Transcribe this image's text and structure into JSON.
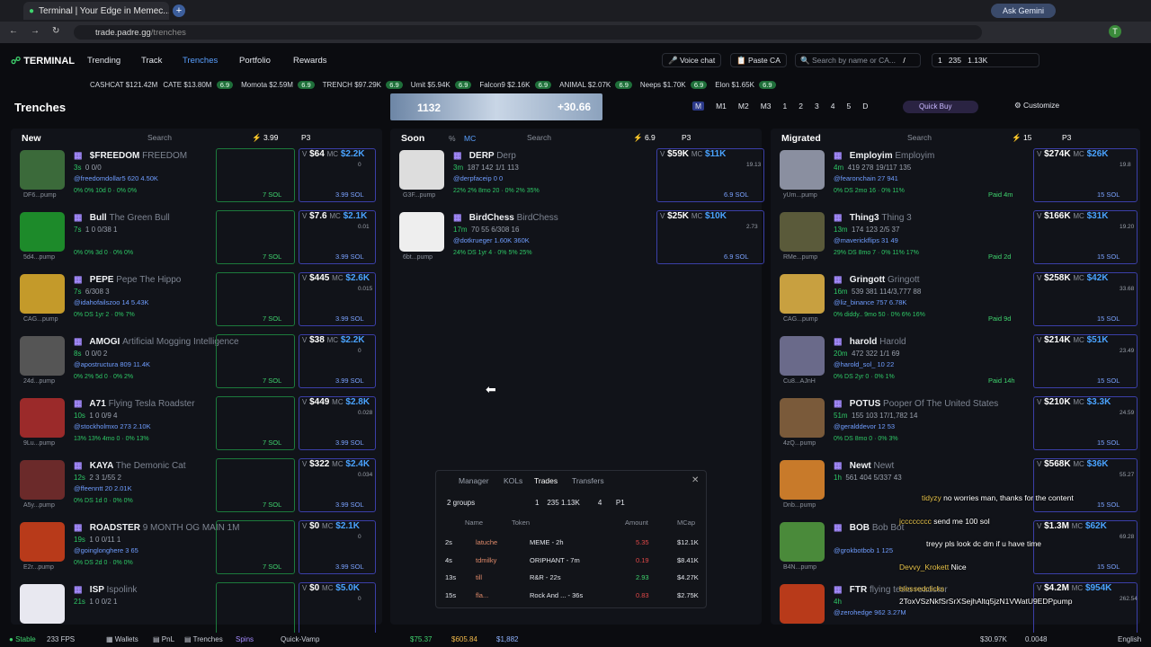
{
  "browser": {
    "tab_title": "Terminal | Your Edge in Memec...",
    "url_host": "trade.padre.gg",
    "url_path": "/trenches",
    "gemini_label": "Ask Gemini",
    "profile_initial": "T"
  },
  "nav": {
    "logo": "TERMINAL",
    "items": [
      "Trending",
      "Track",
      "Trenches",
      "Portfolio",
      "Rewards"
    ],
    "voice_chat": "Voice chat",
    "paste_ca": "Paste CA",
    "search_placeholder": "Search by name or CA...",
    "search_shortcut": "/",
    "wallet_count": "1",
    "wallet_a": "235",
    "wallet_b": "1.13K"
  },
  "ticker": [
    {
      "name": "CASHCAT",
      "value": "$121.42M"
    },
    {
      "name": "CATE",
      "value": "$13.80M",
      "pill": "6.9"
    },
    {
      "name": "Momota",
      "value": "$2.59M",
      "pill": "6.9"
    },
    {
      "name": "TRENCH",
      "value": "$97.29K",
      "pill": "6.9"
    },
    {
      "name": "Umit",
      "value": "$5.94K",
      "pill": "6.9"
    },
    {
      "name": "Falcon9",
      "value": "$2.16K",
      "pill": "6.9"
    },
    {
      "name": "ANIMAL",
      "value": "$2.07K",
      "pill": "6.9"
    },
    {
      "name": "Neeps",
      "value": "$1.70K",
      "pill": "6.9"
    },
    {
      "name": "Elon",
      "value": "$1.65K",
      "pill": "6.9"
    }
  ],
  "banner": {
    "left": "1132",
    "right": "+30.66"
  },
  "trenches": {
    "title": "Trenches",
    "presets": [
      "M",
      "M1",
      "M2",
      "M3",
      "1",
      "2",
      "3",
      "4",
      "5",
      "D"
    ],
    "quick_buy": "Quick Buy",
    "customize": "Customize"
  },
  "columns": {
    "new": {
      "title": "New",
      "search": "Search",
      "amount": "3.99",
      "preset": "P3"
    },
    "soon": {
      "title": "Soon",
      "tab1": "%",
      "tab2": "MC",
      "search": "Search",
      "amount": "6.9",
      "preset": "P3"
    },
    "migrated": {
      "title": "Migrated",
      "search": "Search",
      "amount": "15",
      "preset": "P3"
    }
  },
  "new_cards": [
    {
      "ticker": "$FREEDOM",
      "name": "FREEDOM",
      "age": "3s",
      "stats": "0  0/0",
      "social": "@freedomdollar5  620  4.50K",
      "metrics": "0%  0%  10d  0 · 0%  0%",
      "v": "$64",
      "mc": "$2.2K",
      "f": "0",
      "ca": "DF6...pump",
      "sol": "3.99 SOL",
      "sol2": "7 SOL",
      "img": "#3b6a3a"
    },
    {
      "ticker": "Bull",
      "name": "The Green Bull",
      "age": "7s",
      "stats": "1  0  0/38  1",
      "social": "",
      "metrics": "0%  0%  3d  0 · 0%  0%",
      "v": "$7.6",
      "mc": "$2.1K",
      "f": "0.01",
      "ca": "5d4...pump",
      "sol": "3.99 SOL",
      "sol2": "7 SOL",
      "img": "#1d8a2a"
    },
    {
      "ticker": "PEPE",
      "name": "Pepe The Hippo",
      "age": "7s",
      "stats": "6/308  3",
      "social": "@idahofailszoo  14  5.43K",
      "metrics": "0%  DS  1yr  2 · 0%  7%",
      "v": "$445",
      "mc": "$2.6K",
      "f": "0.015",
      "ca": "CAG...pump",
      "sol": "3.99 SOL",
      "sol2": "7 SOL",
      "img": "#c49a2a"
    },
    {
      "ticker": "AMOGI",
      "name": "Artificial Mogging Intelligence",
      "age": "8s",
      "stats": "0  0/0  2",
      "social": "@apostructura  809  11.4K",
      "metrics": "0%  2%  5d  0 · 0%  2%",
      "v": "$38",
      "mc": "$2.2K",
      "f": "0",
      "ca": "24d...pump",
      "sol": "3.99 SOL",
      "sol2": "7 SOL",
      "img": "#555"
    },
    {
      "ticker": "A71",
      "name": "Flying Tesla Roadster",
      "age": "10s",
      "stats": "1  0  0/9  4",
      "social": "@stockholmxo  273  2.10K",
      "metrics": "13%  13%  4mo  0 · 0%  13%",
      "v": "$449",
      "mc": "$2.8K",
      "f": "0.028",
      "ca": "9Lu...pump",
      "sol": "3.99 SOL",
      "sol2": "7 SOL",
      "img": "#9b2a2a"
    },
    {
      "ticker": "KAYA",
      "name": "The Demonic Cat",
      "age": "12s",
      "stats": "2  3  1/55  2",
      "social": "@ffeenntt  20  2.01K",
      "metrics": "0%  DS  1d  0 · 0%  0%",
      "v": "$322",
      "mc": "$2.4K",
      "f": "0.034",
      "ca": "A5y...pump",
      "sol": "3.99 SOL",
      "sol2": "7 SOL",
      "img": "#6b2a2a"
    },
    {
      "ticker": "ROADSTER",
      "name": "9 MONTH OG MAIN 1M",
      "age": "19s",
      "stats": "1  0  0/11  1",
      "social": "@goinglonghere  3  65",
      "metrics": "0%  DS  2d  0 · 0%  0%",
      "v": "$0",
      "mc": "$2.1K",
      "f": "0",
      "ca": "E2r...pump",
      "sol": "3.99 SOL",
      "sol2": "7 SOL",
      "img": "#b83a1a"
    },
    {
      "ticker": "ISP",
      "name": "Ispolink",
      "age": "21s",
      "stats": "1  0  0/2  1",
      "social": "",
      "metrics": "",
      "v": "$0",
      "mc": "$5.0K",
      "f": "0",
      "ca": "",
      "sol": "",
      "sol2": "",
      "img": "#e8e8f0"
    }
  ],
  "soon_cards": [
    {
      "ticker": "DERP",
      "name": "Derp",
      "age": "3m",
      "stats": "187  142  1/1  113",
      "social": "@derpfaceip  0  0",
      "metrics": "22%  2%  8mo  20 · 0%  2%  35%",
      "v": "$59K",
      "mc": "$11K",
      "f": "19.13",
      "ca": "G3F...pump",
      "sol": "6.9 SOL",
      "img": "#ddd"
    },
    {
      "ticker": "BirdChess",
      "name": "BirdChess",
      "age": "17m",
      "stats": "70  55  6/308  16",
      "social": "@dotkrueger  1.60K  360K",
      "metrics": "24%  DS  1yr  4 · 0%  5%  25%",
      "v": "$25K",
      "mc": "$10K",
      "f": "2.73",
      "ca": "6bt...pump",
      "sol": "6.9 SOL",
      "img": "#eee"
    }
  ],
  "migrated_cards": [
    {
      "ticker": "Employim",
      "name": "Employim",
      "age": "4m",
      "stats": "419  278  19/117  135",
      "social": "@fearonchain  27  941",
      "metrics": "0%  DS  2mo  16 · 0%  11%",
      "v": "$274K",
      "mc": "$26K",
      "f": "19.8",
      "ca": "yUm...pump",
      "paid": "Paid 4m",
      "sol": "15 SOL",
      "img": "#8a8fa0"
    },
    {
      "ticker": "Thing3",
      "name": "Thing 3",
      "age": "13m",
      "stats": "174  123  2/5  37",
      "social": "@maverickflips  31  49",
      "metrics": "29%  DS  8mo  7 · 0%  11%  17%",
      "v": "$166K",
      "mc": "$31K",
      "f": "19.20",
      "ca": "RMe...pump",
      "paid": "Paid 2d",
      "sol": "15 SOL",
      "img": "#5a5a3a"
    },
    {
      "ticker": "Gringott",
      "name": "Gringott",
      "age": "16m",
      "stats": "539  381  114/3,777  88",
      "social": "@liz_binance  757  6.78K",
      "metrics": "0%  diddy..  9mo  50 · 0%  6%  16%",
      "v": "$258K",
      "mc": "$42K",
      "f": "33.68",
      "ca": "CAG...pump",
      "paid": "Paid 9d",
      "sol": "15 SOL",
      "img": "#c8a040"
    },
    {
      "ticker": "harold",
      "name": "Harold",
      "age": "20m",
      "stats": "472  322  1/1  69",
      "social": "@harold_sol_  10  22",
      "metrics": "0%  DS  2yr  0 · 0%  1%",
      "v": "$214K",
      "mc": "$51K",
      "f": "23.49",
      "ca": "Cu8...AJnH",
      "paid": "Paid 14h",
      "sol": "15 SOL",
      "img": "#6a6a8a"
    },
    {
      "ticker": "POTUS",
      "name": "Pooper Of The United States",
      "age": "51m",
      "stats": "155  103  17/1,782  14",
      "social": "@geralddevor  12  53",
      "metrics": "0%  DS  8mo  0 · 0%  3%",
      "v": "$210K",
      "mc": "$3.3K",
      "f": "24.59",
      "ca": "4zQ...pump",
      "paid": "",
      "sol": "15 SOL",
      "img": "#7a5a3a"
    },
    {
      "ticker": "Newt",
      "name": "Newt",
      "age": "1h",
      "stats": "561  404  5/337  43",
      "social": "",
      "metrics": "",
      "v": "$568K",
      "mc": "$36K",
      "f": "55.27",
      "ca": "Dnb...pump",
      "paid": "",
      "sol": "15 SOL",
      "img": "#c87a2a"
    },
    {
      "ticker": "BOB",
      "name": "Bob Bot",
      "age": "",
      "stats": "",
      "social": "@grokbotbob  1  125",
      "metrics": "",
      "v": "$1.3M",
      "mc": "$62K",
      "f": "69.28",
      "ca": "B4N...pump",
      "paid": "",
      "sol": "15 SOL",
      "img": "#4a8a3a"
    },
    {
      "ticker": "FTR",
      "name": "flying tesla roadster",
      "age": "4h",
      "stats": "",
      "social": "@zerohedge  962  3.27M",
      "metrics": "",
      "v": "$4.2M",
      "mc": "$954K",
      "f": "262.54",
      "ca": "",
      "paid": "",
      "sol": "",
      "img": "#b83a1a"
    }
  ],
  "popup": {
    "tabs": [
      "Manager",
      "KOLs",
      "Trades",
      "Transfers"
    ],
    "groups": "2 groups",
    "count1": "1",
    "count2": "235",
    "count3": "1.13K",
    "count4": "4",
    "preset": "P1",
    "headers": [
      "Name",
      "Token",
      "Amount",
      "MCap"
    ],
    "rows": [
      {
        "t": "2s",
        "name": "latuche",
        "token": "MEME - 2h",
        "amt": "5.35",
        "mcap": "$12.1K",
        "amt_color": "#e04848"
      },
      {
        "t": "4s",
        "name": "tdmilky",
        "token": "ORIPHANT - 7m",
        "amt": "0.19",
        "mcap": "$8.41K",
        "amt_color": "#e04848"
      },
      {
        "t": "13s",
        "name": "till",
        "token": "R&R - 22s",
        "amt": "2.93",
        "mcap": "$4.27K",
        "amt_color": "#3fd46e"
      },
      {
        "t": "15s",
        "name": "fla...",
        "token": "Rock And ... - 36s",
        "amt": "0.83",
        "mcap": "$2.75K",
        "amt_color": "#e04848"
      }
    ]
  },
  "chat": [
    {
      "user": "tidyzy",
      "msg": "no worries man, thanks for the content"
    },
    {
      "user": "jcccccccc",
      "msg": "send me 100 sol"
    },
    {
      "user": "",
      "msg": "treyy pls look dc dm if u have time"
    },
    {
      "user": "Devvy_Krokett",
      "msg": "Nice"
    },
    {
      "user": "blessedclicks",
      "msg": ""
    },
    {
      "user": "",
      "msg": "2ToxVSzNkfSrSrXSejhAltq5jzN1VWatU9EDPpump"
    }
  ],
  "bottom": {
    "stable": "Stable",
    "fps": "233 FPS",
    "wallets": "Wallets",
    "pnl": "PnL",
    "trenches": "Trenches",
    "spins": "Spins",
    "quick_vamp": "Quick-Vamp",
    "sol_price": "$75.37",
    "btc_price": "$605.84",
    "eth_price": "$1,882",
    "balance": "$30.97K",
    "bal2": "0.0048",
    "lang": "English"
  }
}
